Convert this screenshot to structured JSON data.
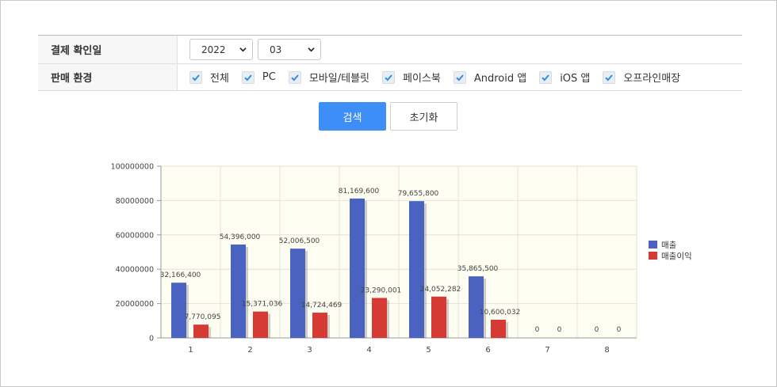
{
  "filters": {
    "date_label": "결제 확인일",
    "year": "2022",
    "month": "03",
    "env_label": "판매 환경",
    "env_options": [
      {
        "label": "전체",
        "checked": true
      },
      {
        "label": "PC",
        "checked": true
      },
      {
        "label": "모바일/테블릿",
        "checked": true
      },
      {
        "label": "페이스북",
        "checked": true
      },
      {
        "label": "Android 앱",
        "checked": true
      },
      {
        "label": "iOS 앱",
        "checked": true
      },
      {
        "label": "오프라인매장",
        "checked": true
      }
    ]
  },
  "buttons": {
    "search": "검색",
    "reset": "초기화"
  },
  "chart_data": {
    "type": "bar",
    "categories": [
      "1",
      "2",
      "3",
      "4",
      "5",
      "6",
      "7",
      "8"
    ],
    "series": [
      {
        "name": "매출",
        "color": "#4a63c0",
        "values": [
          32166400,
          54396000,
          52006500,
          81169600,
          79655800,
          35865500,
          0,
          0
        ],
        "labels": [
          "32,166,400",
          "54,396,000",
          "52,006,500",
          "81,169,600",
          "79,655,800",
          "35,865,500",
          "0",
          "0"
        ]
      },
      {
        "name": "매출이익",
        "color": "#d63a35",
        "values": [
          7770095,
          15371036,
          14724469,
          23290001,
          24052282,
          10600032,
          0,
          0
        ],
        "labels": [
          "7,770,095",
          "15,371,036",
          "14,724,469",
          "23,290,001",
          "24,052,282",
          "10,600,032",
          "0",
          "0"
        ]
      }
    ],
    "ylim": [
      0,
      100000000
    ],
    "yticks": [
      "0",
      "20000000",
      "40000000",
      "60000000",
      "80000000",
      "100000000"
    ],
    "legend_position": "right",
    "grid": true
  }
}
